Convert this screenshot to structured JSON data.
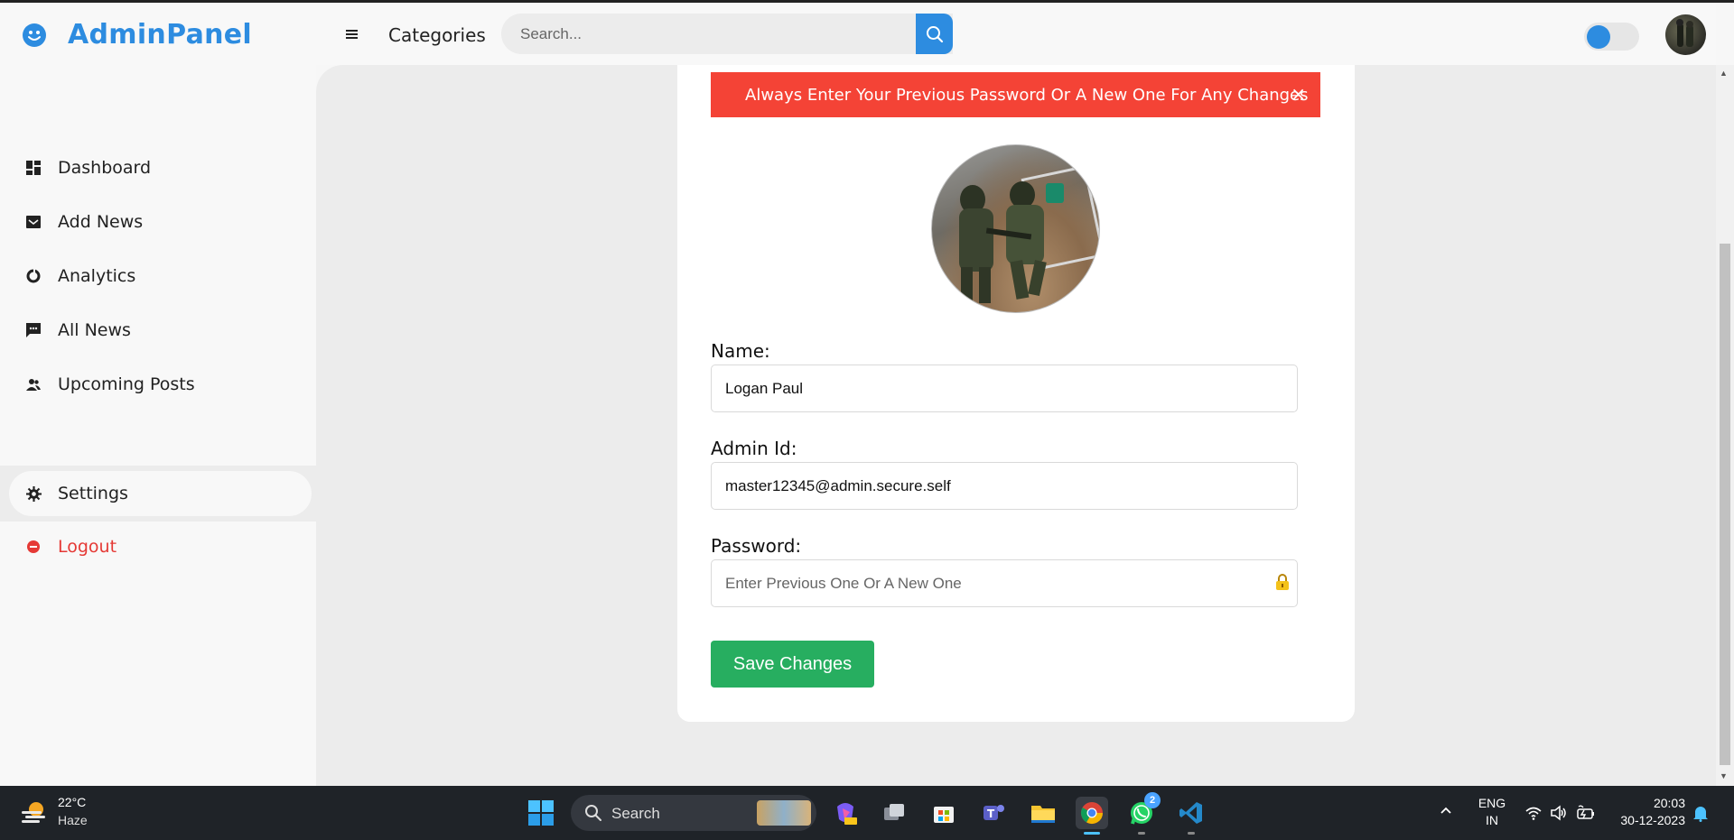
{
  "app": {
    "brand": "AdminPanel",
    "categories_label": "Categories",
    "search_placeholder": "Search...",
    "accent_color": "#2d8ce0"
  },
  "sidebar": {
    "items": [
      {
        "label": "Dashboard",
        "icon": "dashboard-icon"
      },
      {
        "label": "Add News",
        "icon": "inbox-icon"
      },
      {
        "label": "Analytics",
        "icon": "donut-chart-icon"
      },
      {
        "label": "All News",
        "icon": "message-icon"
      },
      {
        "label": "Upcoming Posts",
        "icon": "people-icon"
      }
    ],
    "settings_label": "Settings",
    "logout_label": "Logout",
    "logout_color": "#e53935"
  },
  "settings_form": {
    "alert_text": "Always Enter Your Previous Password Or A New One For Any Changes",
    "alert_close": "×",
    "alert_color": "#f44336",
    "name_label": "Name:",
    "name_value": "Logan Paul",
    "admin_id_label": "Admin Id:",
    "admin_id_value": "master12345@admin.secure.self",
    "password_label": "Password:",
    "password_placeholder": "Enter Previous One Or A New One",
    "save_label": "Save Changes",
    "save_color": "#27ae60"
  },
  "taskbar": {
    "temperature": "22°C",
    "condition": "Haze",
    "search_label": "Search",
    "whatsapp_badge": "2",
    "lang_line1": "ENG",
    "lang_line2": "IN",
    "time": "20:03",
    "date": "30-12-2023"
  }
}
